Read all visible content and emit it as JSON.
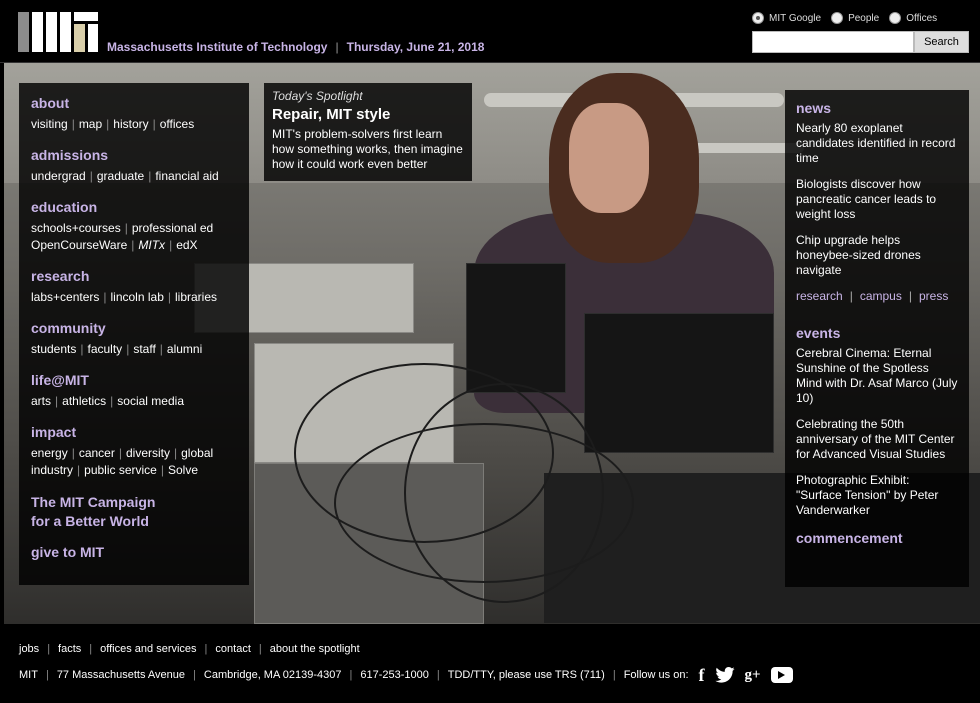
{
  "header": {
    "institute_name": "Massachusetts Institute of Technology",
    "date": "Thursday, June 21, 2018",
    "logo_alt": "MIT"
  },
  "search": {
    "options": [
      "MIT Google",
      "People",
      "Offices"
    ],
    "selected": "MIT Google",
    "input_value": "",
    "button_label": "Search"
  },
  "left_nav": [
    {
      "title": "about",
      "lines": [
        [
          "visiting",
          "map",
          "history",
          "offices"
        ]
      ]
    },
    {
      "title": "admissions",
      "lines": [
        [
          "undergrad",
          "graduate",
          "financial aid"
        ]
      ]
    },
    {
      "title": "education",
      "lines": [
        [
          "schools+courses",
          "professional ed"
        ],
        [
          "OpenCourseWare",
          "MITx",
          "edX"
        ]
      ]
    },
    {
      "title": "research",
      "lines": [
        [
          "labs+centers",
          "lincoln lab",
          "libraries"
        ]
      ]
    },
    {
      "title": "community",
      "lines": [
        [
          "students",
          "faculty",
          "staff",
          "alumni"
        ]
      ]
    },
    {
      "title": "life@MIT",
      "lines": [
        [
          "arts",
          "athletics",
          "social media"
        ]
      ]
    },
    {
      "title": "impact",
      "lines": [
        [
          "energy",
          "cancer",
          "diversity",
          "global"
        ],
        [
          "industry",
          "public service",
          "Solve"
        ]
      ]
    }
  ],
  "campaign": {
    "line1": "The MIT Campaign",
    "line2": "for a Better World"
  },
  "give": "give to MIT",
  "spotlight": {
    "label": "Today's Spotlight",
    "title": "Repair, MIT style",
    "description": "MIT's problem-solvers first learn how something works, then imagine how it could work even better"
  },
  "news": {
    "heading": "news",
    "items": [
      "Nearly 80 exoplanet candidates identified in record time",
      "Biologists discover how pancreatic cancer leads to weight loss",
      "Chip upgrade helps honeybee-sized drones navigate"
    ],
    "links": [
      "research",
      "campus",
      "press"
    ]
  },
  "events": {
    "heading": "events",
    "items": [
      "Cerebral Cinema: Eternal Sunshine of the Spotless Mind with Dr. Asaf Marco (July 10)",
      "Celebrating the 50th anniversary of the MIT Center for Advanced Visual Studies",
      "Photographic Exhibit: \"Surface Tension\" by Peter Vanderwarker"
    ]
  },
  "commencement": "commencement",
  "footer": {
    "row1": [
      "jobs",
      "facts",
      "offices and services",
      "contact",
      "about the spotlight"
    ],
    "row2": [
      "MIT",
      "77 Massachusetts Avenue",
      "Cambridge, MA 02139-4307",
      "617-253-1000",
      "TDD/TTY, please use TRS (711)"
    ],
    "follow_label": "Follow us on:",
    "social": [
      "facebook-icon",
      "twitter-icon",
      "google-plus-icon",
      "youtube-icon"
    ],
    "social_glyphs": {
      "facebook": "f",
      "google_plus": "g+"
    }
  },
  "colors": {
    "accent": "#c8b4e6",
    "logo_red": "#a31f34",
    "background": "#000000"
  }
}
